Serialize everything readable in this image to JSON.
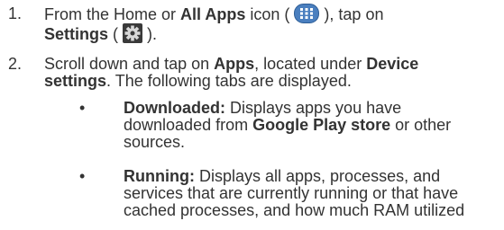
{
  "steps": [
    {
      "number": "1.",
      "line1_pre": "From the Home or ",
      "line1_bold": "All Apps",
      "line1_post_a": " icon ( ",
      "line1_post_b": " ), tap on",
      "line2_bold": "Settings",
      "line2_mid": " ( ",
      "line2_post": " )."
    },
    {
      "number": "2.",
      "line1_pre": "Scroll down and tap on ",
      "line1_bold_a": "Apps",
      "line1_mid": ", located under ",
      "line1_bold_b": "Device",
      "line2_bold": "settings",
      "line2_post": ". The following tabs are displayed."
    }
  ],
  "bullets": [
    {
      "dot": "•",
      "label": "Downloaded:",
      "line1_post": " Displays apps you have",
      "line2_pre": "downloaded from ",
      "line2_bold": "Google Play store",
      "line2_post": " or other",
      "line3": "sources."
    },
    {
      "dot": "•",
      "label": "Running:",
      "line1_post": " Displays all apps, processes, and",
      "line2": "services that are currently running or that have",
      "line3": "cached processes, and how much RAM utilized"
    }
  ],
  "icons": {
    "apps_icon": "all-apps-grid-icon",
    "settings_icon": "settings-gear-icon",
    "apps_icon_color": "#4a7fbf",
    "settings_icon_color": "#5a5a5a"
  }
}
